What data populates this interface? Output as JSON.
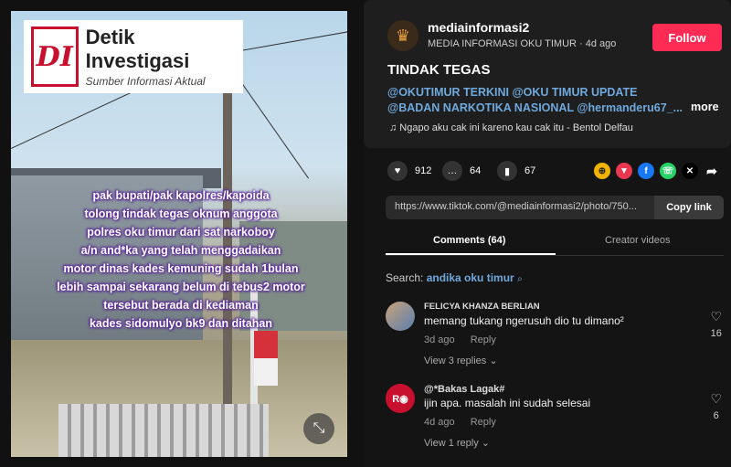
{
  "post_image": {
    "brand_title": "Detik Investigasi",
    "brand_subtitle": "Sumber Informasi Aktual",
    "brand_mark": "DI",
    "overlay_lines": [
      "pak bupati/pak kapolres/kapoida",
      "tolong tindak tegas oknum anggota",
      "polres oku timur dari sat narkoboy",
      "a/n and*ka yang telah menggadaikan",
      "motor dinas kades kemuning sudah 1bulan",
      "lebih sampai sekarang belum di tebus2 motor",
      "tersebut berada di kediaman",
      "kades sidomulyo bk9 dan ditahan"
    ],
    "expand_icon": "expand-icon"
  },
  "author": {
    "username": "mediainformasi2",
    "meta": "MEDIA INFORMASI OKU TIMUR · 4d ago",
    "follow_label": "Follow"
  },
  "post": {
    "title": "TINDAK TEGAS",
    "tags_line1": "@OKUTIMUR TERKINI @OKU TIMUR UPDATE",
    "tags_line2": "@BADAN NARKOTIKA NASIONAL @hermanderu67_...",
    "more_label": "more",
    "music": "♫  Ngapo aku cak ini kareno kau cak itu - Bentol Delfau"
  },
  "stats": {
    "likes": "912",
    "comments": "64",
    "saves": "67"
  },
  "link": {
    "url": "https://www.tiktok.com/@mediainformasi2/photo/750...",
    "copy_label": "Copy link"
  },
  "tabs": {
    "comments": "Comments (64)",
    "creator": "Creator videos"
  },
  "search": {
    "prefix": "Search:",
    "query": "andika oku timur"
  },
  "comments": [
    {
      "name": "FELICYA KHANZA BERLIAN",
      "text": "memang tukang ngerusuh dio tu dimano²",
      "time": "3d ago",
      "reply": "Reply",
      "view_replies": "View 3 replies ⌄",
      "likes": "16"
    },
    {
      "name": "@*Bakas Lagak#",
      "text": "ijin apa. masalah ini sudah selesai",
      "time": "4d ago",
      "reply": "Reply",
      "view_replies": "View 1 reply ⌄",
      "likes": "6"
    }
  ],
  "colors": {
    "follow": "#fe2c55",
    "link_blue": "#6fa8dc",
    "overlay_outline": "#5b2a9c"
  }
}
